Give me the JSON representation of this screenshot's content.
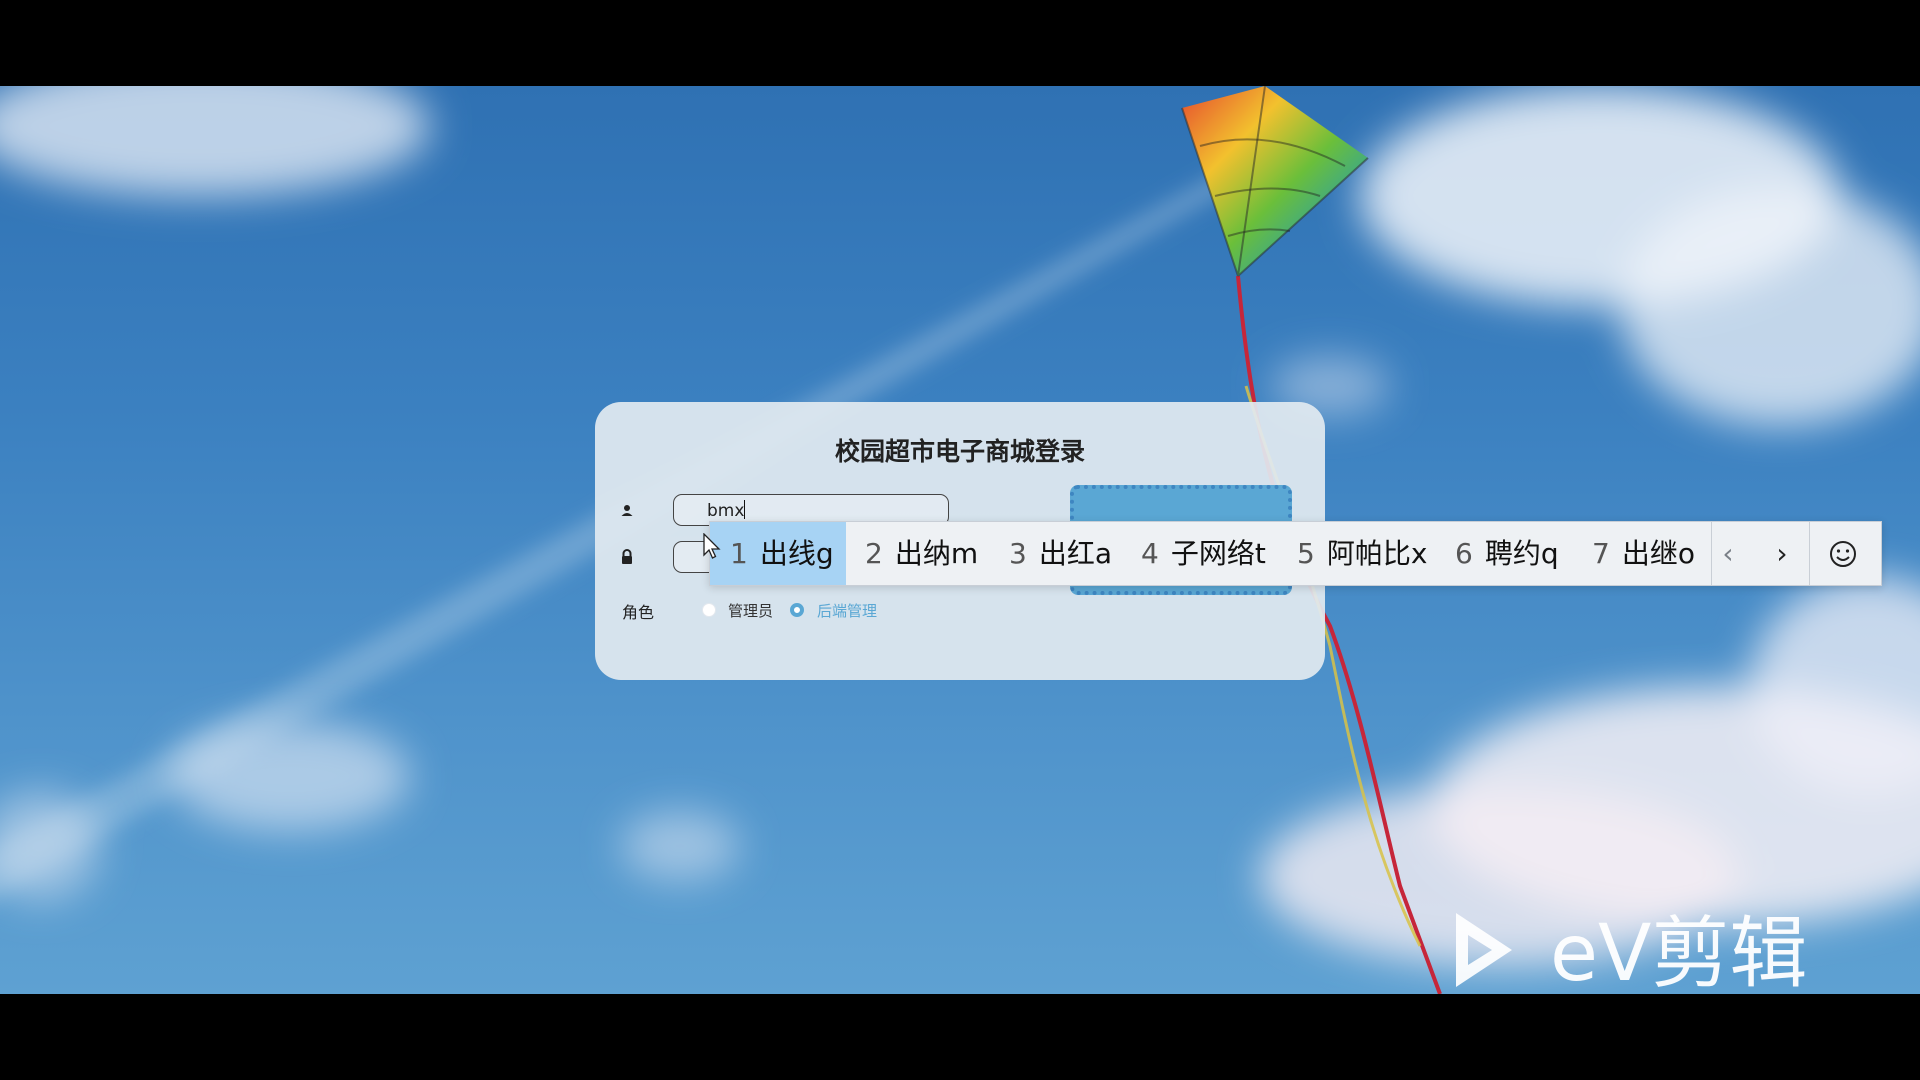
{
  "login": {
    "title": "校园超市电子商城登录",
    "username_value": "bmx",
    "role_label": "角色",
    "role_options": [
      {
        "label": "管理员",
        "selected": false
      },
      {
        "label": "后端管理",
        "selected": true
      }
    ]
  },
  "ime": {
    "candidates": [
      {
        "index": "1",
        "text": "出线g",
        "selected": true
      },
      {
        "index": "2",
        "text": "出纳m",
        "selected": false
      },
      {
        "index": "3",
        "text": "出红a",
        "selected": false
      },
      {
        "index": "4",
        "text": "子网络t",
        "selected": false
      },
      {
        "index": "5",
        "text": "阿帕比x",
        "selected": false
      },
      {
        "index": "6",
        "text": "聘约q",
        "selected": false
      },
      {
        "index": "7",
        "text": "出继o",
        "selected": false
      }
    ],
    "prev_glyph": "‹",
    "next_glyph": "›"
  },
  "icons": {
    "username": "user-icon",
    "password": "lock-icon",
    "ime_emoji": "smiley-icon",
    "cursor": "mouse-pointer-icon"
  },
  "watermark": {
    "text": "eV剪辑"
  },
  "colors": {
    "accent": "#5aa7d4",
    "ime_selected": "#a7d3f4",
    "card_bg": "#e1e9f0"
  }
}
